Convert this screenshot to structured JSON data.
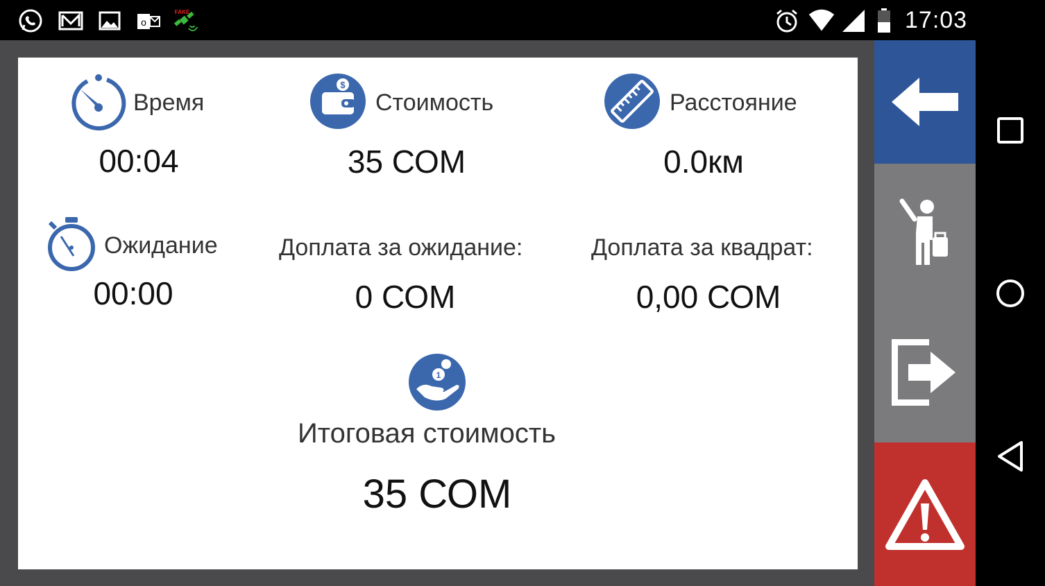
{
  "status_bar": {
    "time": "17:03",
    "left_icons": [
      "whatsapp-icon",
      "mail-icon",
      "gallery-icon",
      "outlook-icon",
      "fake-gps-icon"
    ],
    "fake_label": "FAKE",
    "right_icons": [
      "alarm-icon",
      "wifi-icon",
      "signal-icon",
      "battery-icon"
    ]
  },
  "stats": {
    "time": {
      "label": "Время",
      "value": "00:04"
    },
    "cost": {
      "label": "Стоимость",
      "value": "35 СОМ"
    },
    "distance": {
      "label": "Расстояние",
      "value": "0.0км"
    },
    "waiting": {
      "label": "Ожидание",
      "value": "00:00"
    },
    "waiting_surcharge": {
      "label": "Доплата за ожидание:",
      "value": "0 СОМ"
    },
    "square_surcharge": {
      "label": "Доплата за квадрат:",
      "value": "0,00 СОМ"
    },
    "total": {
      "label": "Итоговая стоимость",
      "value": "35 СОМ"
    }
  },
  "side_buttons": [
    "back-arrow-icon",
    "passenger-icon",
    "exit-icon",
    "warning-icon"
  ],
  "nav_buttons": [
    "recents-icon",
    "home-icon",
    "back-icon"
  ],
  "colors": {
    "accent_blue": "#2d5597",
    "icon_blue": "#3b67ad",
    "side_gray": "#7b7b7d",
    "sos_red": "#c0302d",
    "frame_gray": "#4a4a4c"
  }
}
